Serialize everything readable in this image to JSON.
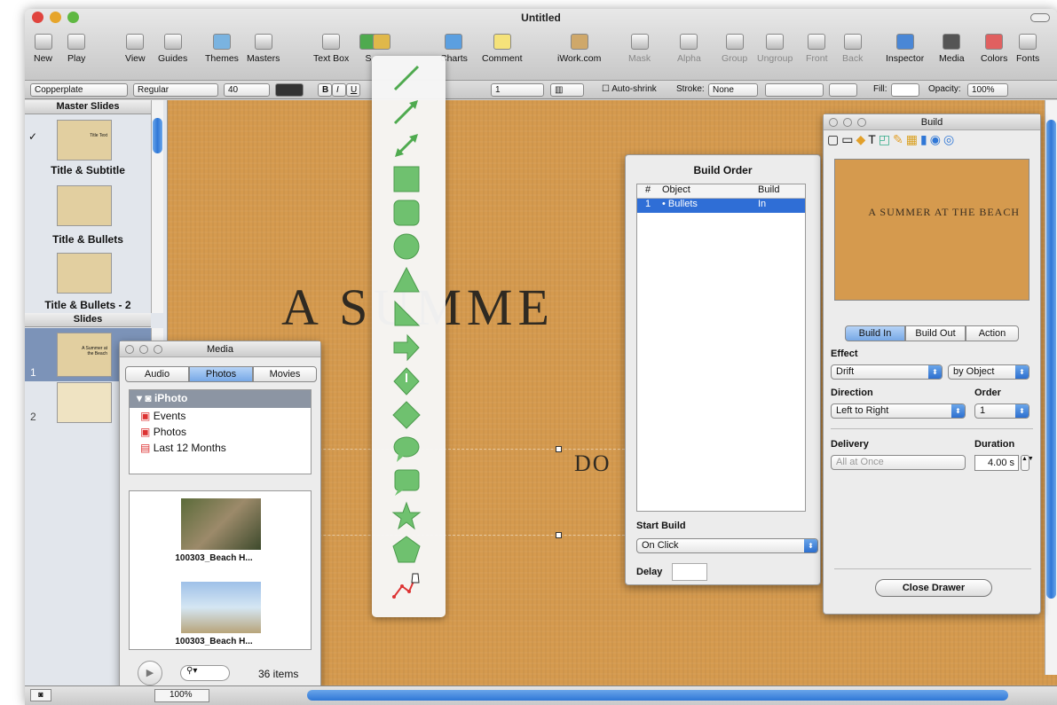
{
  "window": {
    "title": "Untitled"
  },
  "toolbar": {
    "items": [
      {
        "label": "New",
        "icon": "plus-icon"
      },
      {
        "label": "Play",
        "icon": "play-icon"
      },
      {
        "label": "View",
        "icon": "view-icon"
      },
      {
        "label": "Guides",
        "icon": "guides-icon"
      },
      {
        "label": "Themes",
        "icon": "themes-icon"
      },
      {
        "label": "Masters",
        "icon": "masters-icon"
      },
      {
        "label": "Text Box",
        "icon": "textbox-icon"
      },
      {
        "label": "S",
        "icon": "shapes-icon"
      },
      {
        "label": "",
        "icon": "table-icon"
      },
      {
        "label": "Charts",
        "icon": "charts-icon"
      },
      {
        "label": "Comment",
        "icon": "comment-icon"
      },
      {
        "label": "iWork.com",
        "icon": "iwork-icon"
      },
      {
        "label": "Mask",
        "icon": "mask-icon"
      },
      {
        "label": "Alpha",
        "icon": "alpha-icon"
      },
      {
        "label": "Group",
        "icon": "group-icon"
      },
      {
        "label": "Ungroup",
        "icon": "ungroup-icon"
      },
      {
        "label": "Front",
        "icon": "front-icon"
      },
      {
        "label": "Back",
        "icon": "back-icon"
      },
      {
        "label": "Inspector",
        "icon": "inspector-icon"
      },
      {
        "label": "Media",
        "icon": "media-icon"
      },
      {
        "label": "Colors",
        "icon": "colors-icon"
      },
      {
        "label": "Fonts",
        "icon": "fonts-icon"
      }
    ]
  },
  "format_bar": {
    "font": "Copperplate",
    "style": "Regular",
    "size": "40",
    "bold": "B",
    "italic": "I",
    "underline": "U",
    "line_spacing": "1",
    "autoshrink": "Auto-shrink",
    "stroke_label": "Stroke:",
    "stroke_value": "None",
    "fill_label": "Fill:",
    "opacity_label": "Opacity:",
    "opacity_value": "100%"
  },
  "sidebar": {
    "master_header": "Master Slides",
    "masters": [
      "Title & Subtitle",
      "Title & Bullets",
      "Title & Bullets - 2"
    ],
    "slides_header": "Slides",
    "slides": [
      "1",
      "2"
    ],
    "thumb_title_text": "Title Text",
    "slide1_text": "A Summer at the Beach"
  },
  "canvas": {
    "title": "A SUMME",
    "subtitle": "DO"
  },
  "media": {
    "title": "Media",
    "tabs": [
      "Audio",
      "Photos",
      "Movies"
    ],
    "active_tab": "Photos",
    "source_root": "iPhoto",
    "sources": [
      "Events",
      "Photos",
      "Last 12 Months"
    ],
    "photos": [
      "100303_Beach H...",
      "100303_Beach H..."
    ],
    "count": "36 items"
  },
  "build_order": {
    "title": "Build Order",
    "columns": [
      "#",
      "Object",
      "Build"
    ],
    "rows": [
      {
        "num": "1",
        "object": "• Bullets",
        "build": "In"
      }
    ],
    "start_build_label": "Start Build",
    "start_build_value": "On Click",
    "delay_label": "Delay"
  },
  "build": {
    "title": "Build",
    "preview_text": "A Summer at the Beach",
    "tabs": [
      "Build In",
      "Build Out",
      "Action"
    ],
    "active_tab": "Build In",
    "effect_label": "Effect",
    "effect_value": "Drift",
    "effect_scope": "by Object",
    "direction_label": "Direction",
    "direction_value": "Left to Right",
    "order_label": "Order",
    "order_value": "1",
    "delivery_label": "Delivery",
    "delivery_value": "All at Once",
    "duration_label": "Duration",
    "duration_value": "4.00 s",
    "close_button": "Close Drawer"
  },
  "bottom": {
    "zoom": "100%"
  },
  "colors": {
    "accent": "#2f77d6",
    "canvas": "#d59a4e",
    "shape_green": "#6fc16f"
  }
}
